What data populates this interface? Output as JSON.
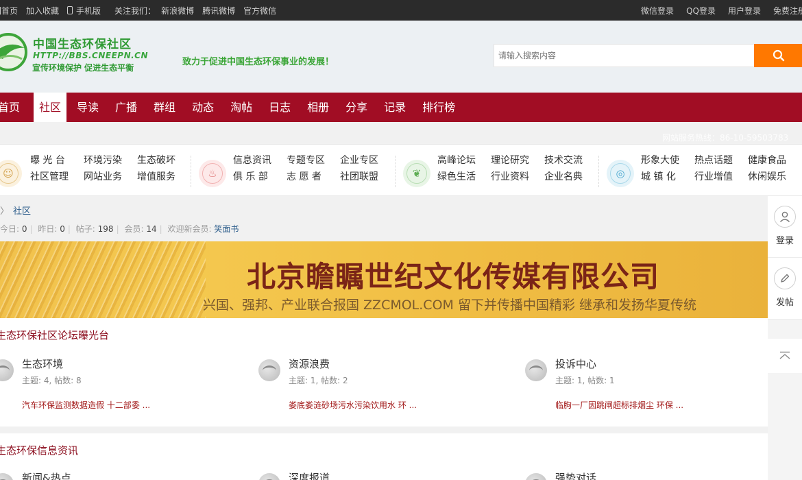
{
  "topbar": {
    "left": [
      "回首页",
      "加入收藏",
      "手机版"
    ],
    "follow_label": "关注我们：",
    "follow_links": [
      "新浪微博",
      "腾讯微博",
      "官方微信"
    ],
    "right": [
      "微信登录",
      "QQ登录",
      "用户登录",
      "免费注册"
    ]
  },
  "header": {
    "logo_title": "中国生态环保社区",
    "logo_url": "HTTP://BBS.CNEEPN.CN",
    "logo_sub": "宣传环境保护  促进生态平衡",
    "slogan": "致力于促进中国生态环保事业的发展！",
    "search_placeholder": "请输入搜索内容",
    "search_icon": "search-icon"
  },
  "nav": {
    "items": [
      "首页",
      "社区",
      "导读",
      "广播",
      "群组",
      "动态",
      "淘帖",
      "日志",
      "相册",
      "分享",
      "记录",
      "排行榜"
    ],
    "active": "社区"
  },
  "hotline": "网站服务热线：86-10-59503783",
  "categories": [
    {
      "icon": "people-icon",
      "color": "#e7c98f",
      "links": [
        "曝 光 台",
        "环境污染",
        "生态破坏",
        "社区管理",
        "网站业务",
        "增值服务"
      ]
    },
    {
      "icon": "fire-icon",
      "color": "#f1b2b2",
      "links": [
        "信息资讯",
        "专题专区",
        "企业专区",
        "俱 乐 部",
        "志 愿 者",
        "社团联盟"
      ]
    },
    {
      "icon": "leaf-icon",
      "color": "#b9deb5",
      "links": [
        "高峰论坛",
        "理论研究",
        "技术交流",
        "绿色生活",
        "行业资料",
        "企业名典"
      ]
    },
    {
      "icon": "target-icon",
      "color": "#a9d8ea",
      "links": [
        "形象大使",
        "热点话题",
        "健康食品",
        "城 镇 化",
        "行业增值",
        "休闲娱乐"
      ]
    }
  ],
  "breadcrumb": {
    "current": "社区"
  },
  "stats": {
    "today_label": "今日:",
    "today": "0",
    "yesterday_label": "昨日:",
    "yesterday": "0",
    "posts_label": "帖子:",
    "posts": "198",
    "members_label": "会员:",
    "members": "14",
    "welcome_label": "欢迎新会员:",
    "newest_member": "笑面书"
  },
  "banner": {
    "company": "北京瞻瞩世纪文化传媒有限公司",
    "motto": "兴国、强邦、产业联合报国 ZZCMOL.COM 留下并传播中国精彩 继承和发扬华夏传统"
  },
  "sections": [
    {
      "title": "生态环保社区论坛曝光台",
      "forums": [
        {
          "name": "生态环境",
          "stat": "主题: 4, 帖数: 8",
          "latest": "汽车环保监测数据造假 十二部委 ..."
        },
        {
          "name": "资源浪费",
          "stat": "主题: 1, 帖数: 2",
          "latest": "娄底娄涟砂场污水污染饮用水 环 ..."
        },
        {
          "name": "投诉中心",
          "stat": "主题: 1, 帖数: 1",
          "latest": "临朐一厂因跳闸超标排烟尘 环保 ..."
        }
      ]
    },
    {
      "title": "生态环保信息资讯",
      "forums": [
        {
          "name": "新闻&热点"
        },
        {
          "name": "深度报道"
        },
        {
          "name": "强势对话"
        }
      ]
    }
  ],
  "sidebar": {
    "login": "登录",
    "post": "发帖"
  }
}
